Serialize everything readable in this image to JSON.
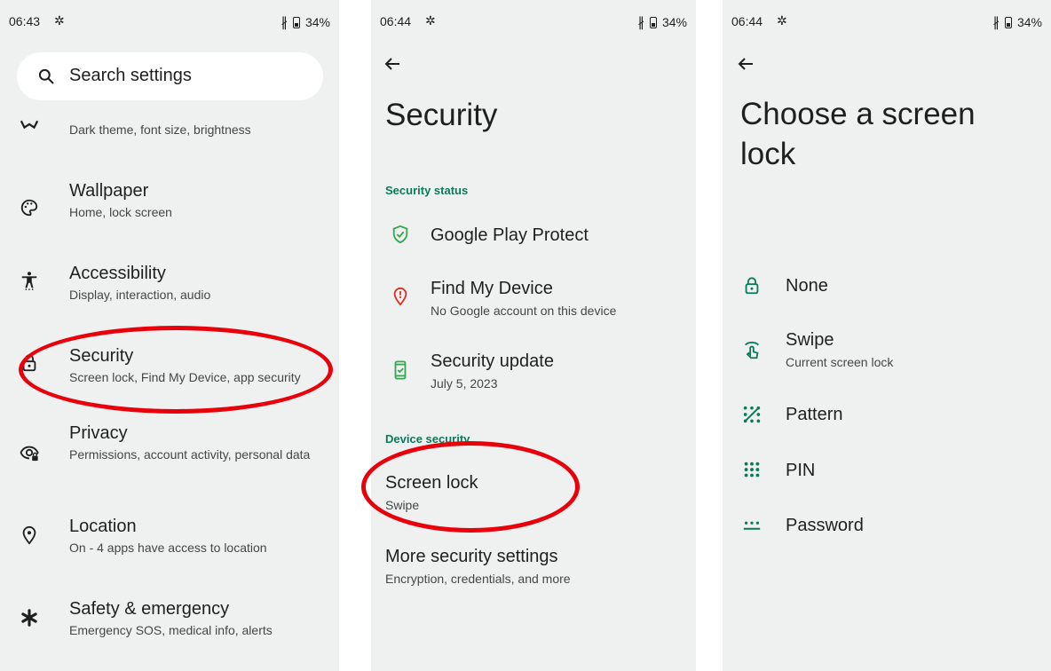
{
  "colors": {
    "panel_bg": "#eff1f0",
    "accent_green": "#0b7a5a",
    "highlight_red": "#e8000b",
    "shield_green": "#34a853",
    "alert_red": "#d93025"
  },
  "panel1": {
    "status": {
      "time": "06:43",
      "battery": "34%"
    },
    "search": {
      "placeholder": "Search settings"
    },
    "items": [
      {
        "title": "",
        "sub": "Dark theme, font size, brightness",
        "icon": "display-icon"
      },
      {
        "title": "Wallpaper",
        "sub": "Home, lock screen",
        "icon": "palette-icon"
      },
      {
        "title": "Accessibility",
        "sub": "Display, interaction, audio",
        "icon": "accessibility-icon"
      },
      {
        "title": "Security",
        "sub": "Screen lock, Find My Device, app security",
        "icon": "lock-icon"
      },
      {
        "title": "Privacy",
        "sub": "Permissions, account activity, personal data",
        "icon": "privacy-eye-icon"
      },
      {
        "title": "Location",
        "sub": "On - 4 apps have access to location",
        "icon": "location-pin-icon"
      },
      {
        "title": "Safety & emergency",
        "sub": "Emergency SOS, medical info, alerts",
        "icon": "asterisk-icon"
      }
    ]
  },
  "panel2": {
    "status": {
      "time": "06:44",
      "battery": "34%"
    },
    "title": "Security",
    "section_status": "Security status",
    "items": [
      {
        "title": "Google Play Protect",
        "sub": "",
        "icon": "shield-check-icon"
      },
      {
        "title": "Find My Device",
        "sub": "No Google account on this device",
        "icon": "find-device-icon"
      },
      {
        "title": "Security update",
        "sub": "July 5, 2023",
        "icon": "phone-check-icon"
      }
    ],
    "section_device": "Device security",
    "screen_lock": {
      "title": "Screen lock",
      "sub": "Swipe"
    },
    "more": {
      "title": "More security settings",
      "sub": "Encryption, credentials, and more"
    }
  },
  "panel3": {
    "status": {
      "time": "06:44",
      "battery": "34%"
    },
    "title": "Choose a screen lock",
    "options": [
      {
        "title": "None",
        "sub": "",
        "icon": "lock-open-icon"
      },
      {
        "title": "Swipe",
        "sub": "Current screen lock",
        "icon": "swipe-icon"
      },
      {
        "title": "Pattern",
        "sub": "",
        "icon": "pattern-icon"
      },
      {
        "title": "PIN",
        "sub": "",
        "icon": "pin-dots-icon"
      },
      {
        "title": "Password",
        "sub": "",
        "icon": "password-icon"
      }
    ]
  }
}
